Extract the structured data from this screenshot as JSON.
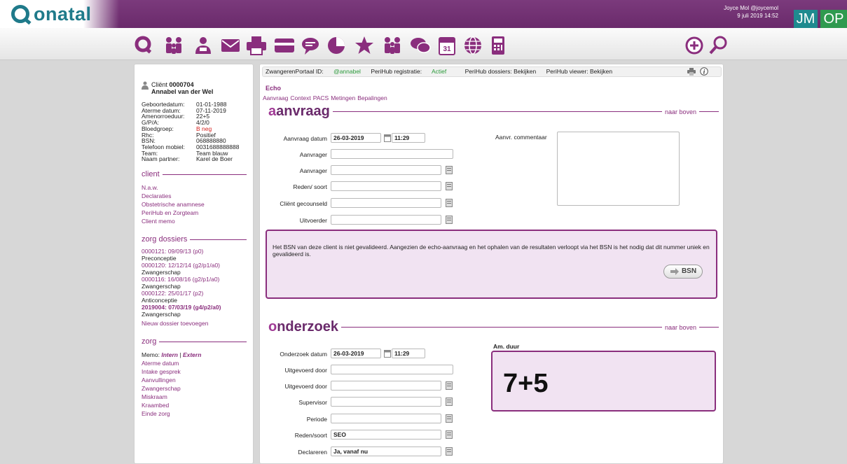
{
  "header": {
    "brand": "onatal",
    "user_line1": "Joyce Mol @joycemol",
    "user_line2": "9 juli 2019 14:52",
    "initials": "JM",
    "op": "OP"
  },
  "toolbar": {
    "icons": [
      "onatal-q-icon",
      "family-icon",
      "person-icon",
      "mail-icon",
      "printer-icon",
      "card-icon",
      "chat-bubble-icon",
      "chart-icon",
      "star-icon",
      "team-icon",
      "conversation-icon",
      "calendar-icon",
      "globe-icon",
      "calculator-icon",
      "add-icon",
      "search-icon"
    ],
    "calendar_day": "31"
  },
  "client": {
    "label": "Cliënt",
    "id": "0000704",
    "name": "Annabel van der Wel",
    "fields": [
      [
        "Geboortedatum:",
        "01-01-1988"
      ],
      [
        "Aterme datum:",
        "07-11-2019"
      ],
      [
        "Amenorroeduur:",
        "22+5"
      ],
      [
        "G/P/A:",
        "4/2/0"
      ],
      [
        "Bloedgroep:",
        "B neg"
      ],
      [
        "Rhc:",
        "Positief"
      ],
      [
        "BSN:",
        "068888880"
      ],
      [
        "Telefoon mobiel:",
        "0031688888888"
      ],
      [
        "Team:",
        "Team blauw"
      ],
      [
        "Naam partner:",
        "Karel de Boer"
      ]
    ]
  },
  "sidebar": {
    "client_title": "client",
    "client_links": [
      "N.a.w.",
      "Declaraties",
      "Obstetrische anamnese",
      "PeriHub en Zorgteam",
      "Client memo"
    ],
    "dossiers_title": "zorg dossiers",
    "dossiers": [
      {
        "code": "0000121: 09/09/13 (p0)",
        "type": "Preconceptie"
      },
      {
        "code": "0000120: 12/12/14 (g2/p1/a0)",
        "type": "Zwangerschap"
      },
      {
        "code": "0000116: 16/08/16 (g2/p1/a0)",
        "type": "Zwangerschap"
      },
      {
        "code": "0000122: 25/01/17 (p2)",
        "type": "Anticonceptie"
      },
      {
        "code": "2019004: 07/03/19 (g4/p2/a0)",
        "type": "Zwangerschap"
      }
    ],
    "new_dossier": "Nieuw dossier toevoegen",
    "zorg_title": "zorg",
    "memo_label": "Memo:",
    "memo_intern": "Intern",
    "memo_sep": "|",
    "memo_extern": "Extern",
    "zorg_links": [
      "Aterme datum",
      "Intake gesprek",
      "Aanvullingen",
      "Zwangerschap",
      "Miskraam",
      "Kraambed",
      "Einde zorg"
    ]
  },
  "portal": {
    "zp_label": "ZwangerenPortaal ID:",
    "zp_value": "@annabel",
    "reg_label": "PeriHub registratie:",
    "reg_value": "Actief",
    "dossiers": "PeriHub dossiers: Bekijken",
    "viewer": "PeriHub viewer: Bekijken"
  },
  "echo": {
    "title": "Echo",
    "tabs": [
      "Aanvraag",
      "Context",
      "PACS",
      "Metingen",
      "Bepalingen"
    ]
  },
  "aanvraag": {
    "title_first": "a",
    "title_rest": "anvraag",
    "naar_boven": "naar boven",
    "datum_label": "Aanvraag datum",
    "datum": "26-03-2019",
    "tijd": "11:29",
    "aanvrager1": "Aanvrager",
    "aanvrager2": "Aanvrager",
    "reden": "Reden/ soort",
    "gecounseld": "Cliënt gecounseld",
    "uitvoerder": "Uitvoerder",
    "commentaar_label": "Aanvr. commentaar"
  },
  "warning": {
    "text": "Het BSN van deze client is niet gevalideerd. Aangezien de echo-aanvraag en het ophalen van de resultaten verloopt via het BSN is het nodig dat dit nummer uniek en gevalideerd is.",
    "button": "BSN"
  },
  "onderzoek": {
    "title_first": "o",
    "title_rest": "nderzoek",
    "naar_boven": "naar boven",
    "datum_label": "Onderzoek datum",
    "datum": "26-03-2019",
    "tijd": "11:29",
    "uitgevoerd1": "Uitgevoerd door",
    "uitgevoerd2": "Uitgevoerd door",
    "supervisor": "Supervisor",
    "periode": "Periode",
    "reden_label": "Reden/soort",
    "reden": "SEO",
    "declareren_label": "Declareren",
    "declareren": "Ja, vanaf nu",
    "duur_label": "Am. duur",
    "duur": "7+5"
  },
  "colors": {
    "purple": "#8a2e7d",
    "teal": "#1f7a8a",
    "red": "#d6231f",
    "green": "#2a9a3a"
  }
}
